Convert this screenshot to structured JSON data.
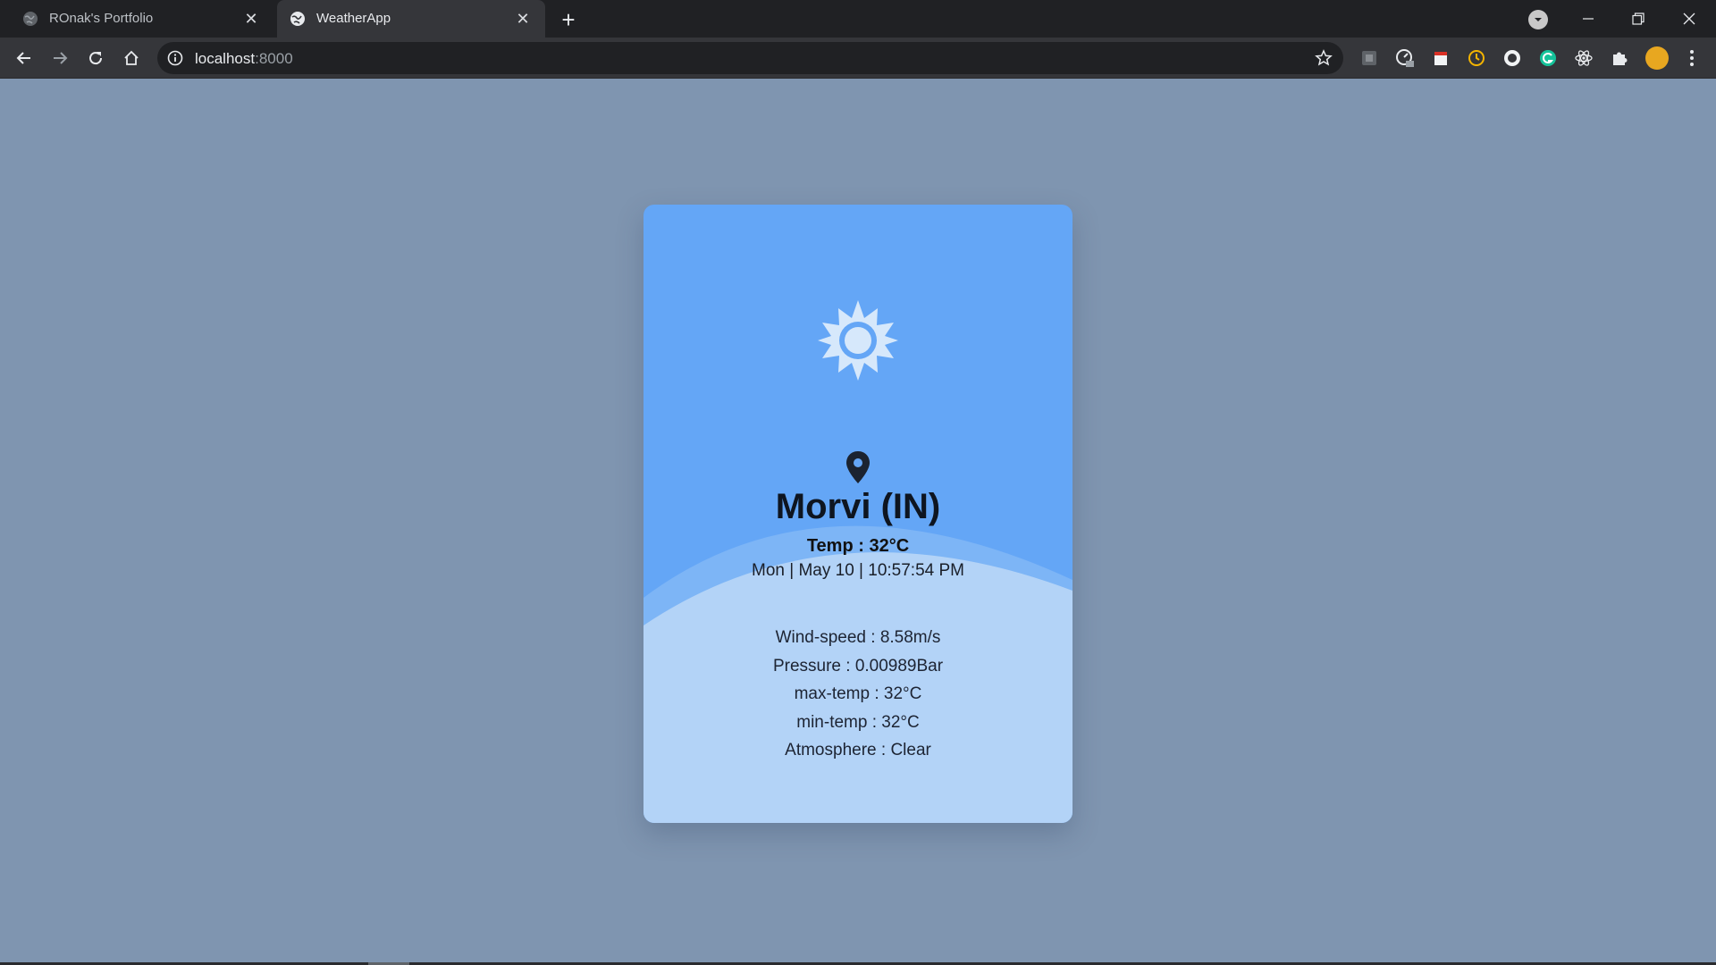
{
  "browser": {
    "tabs": [
      {
        "title": "ROnak's Portfolio",
        "active": false
      },
      {
        "title": "WeatherApp",
        "active": true
      }
    ],
    "new_tab_symbol": "+",
    "close_symbol": "✕",
    "address": {
      "host": "localhost",
      "port": ":8000"
    },
    "extension_icons": [
      "square-icon",
      "gauge-icon",
      "clipboard-icon",
      "clock-icon",
      "circle-icon",
      "grammarly-icon",
      "react-icon",
      "puzzle-icon"
    ],
    "colors": {
      "tabstrip": "#202124",
      "toolbar": "#35363a",
      "page_bg": "#7f95b0"
    }
  },
  "weather_card": {
    "icon": "sun-icon",
    "location_icon": "map-pin-icon",
    "city": "Morvi (IN)",
    "temp_label": "Temp : ",
    "temp_value": "32°C",
    "datetime": "Mon | May 10 | 10:57:54 PM",
    "details": [
      {
        "label": "Wind-speed : ",
        "value": "8.58m/s"
      },
      {
        "label": "Pressure : ",
        "value": "0.00989Bar"
      },
      {
        "label": "max-temp : ",
        "value": "32°C"
      },
      {
        "label": "min-temp : ",
        "value": "32°C"
      },
      {
        "label": "Atmosphere : ",
        "value": "Clear"
      }
    ],
    "colors": {
      "top": "#64a6f6",
      "bottom": "#b3d3f7",
      "wave_mid": "#86b9f5"
    }
  }
}
